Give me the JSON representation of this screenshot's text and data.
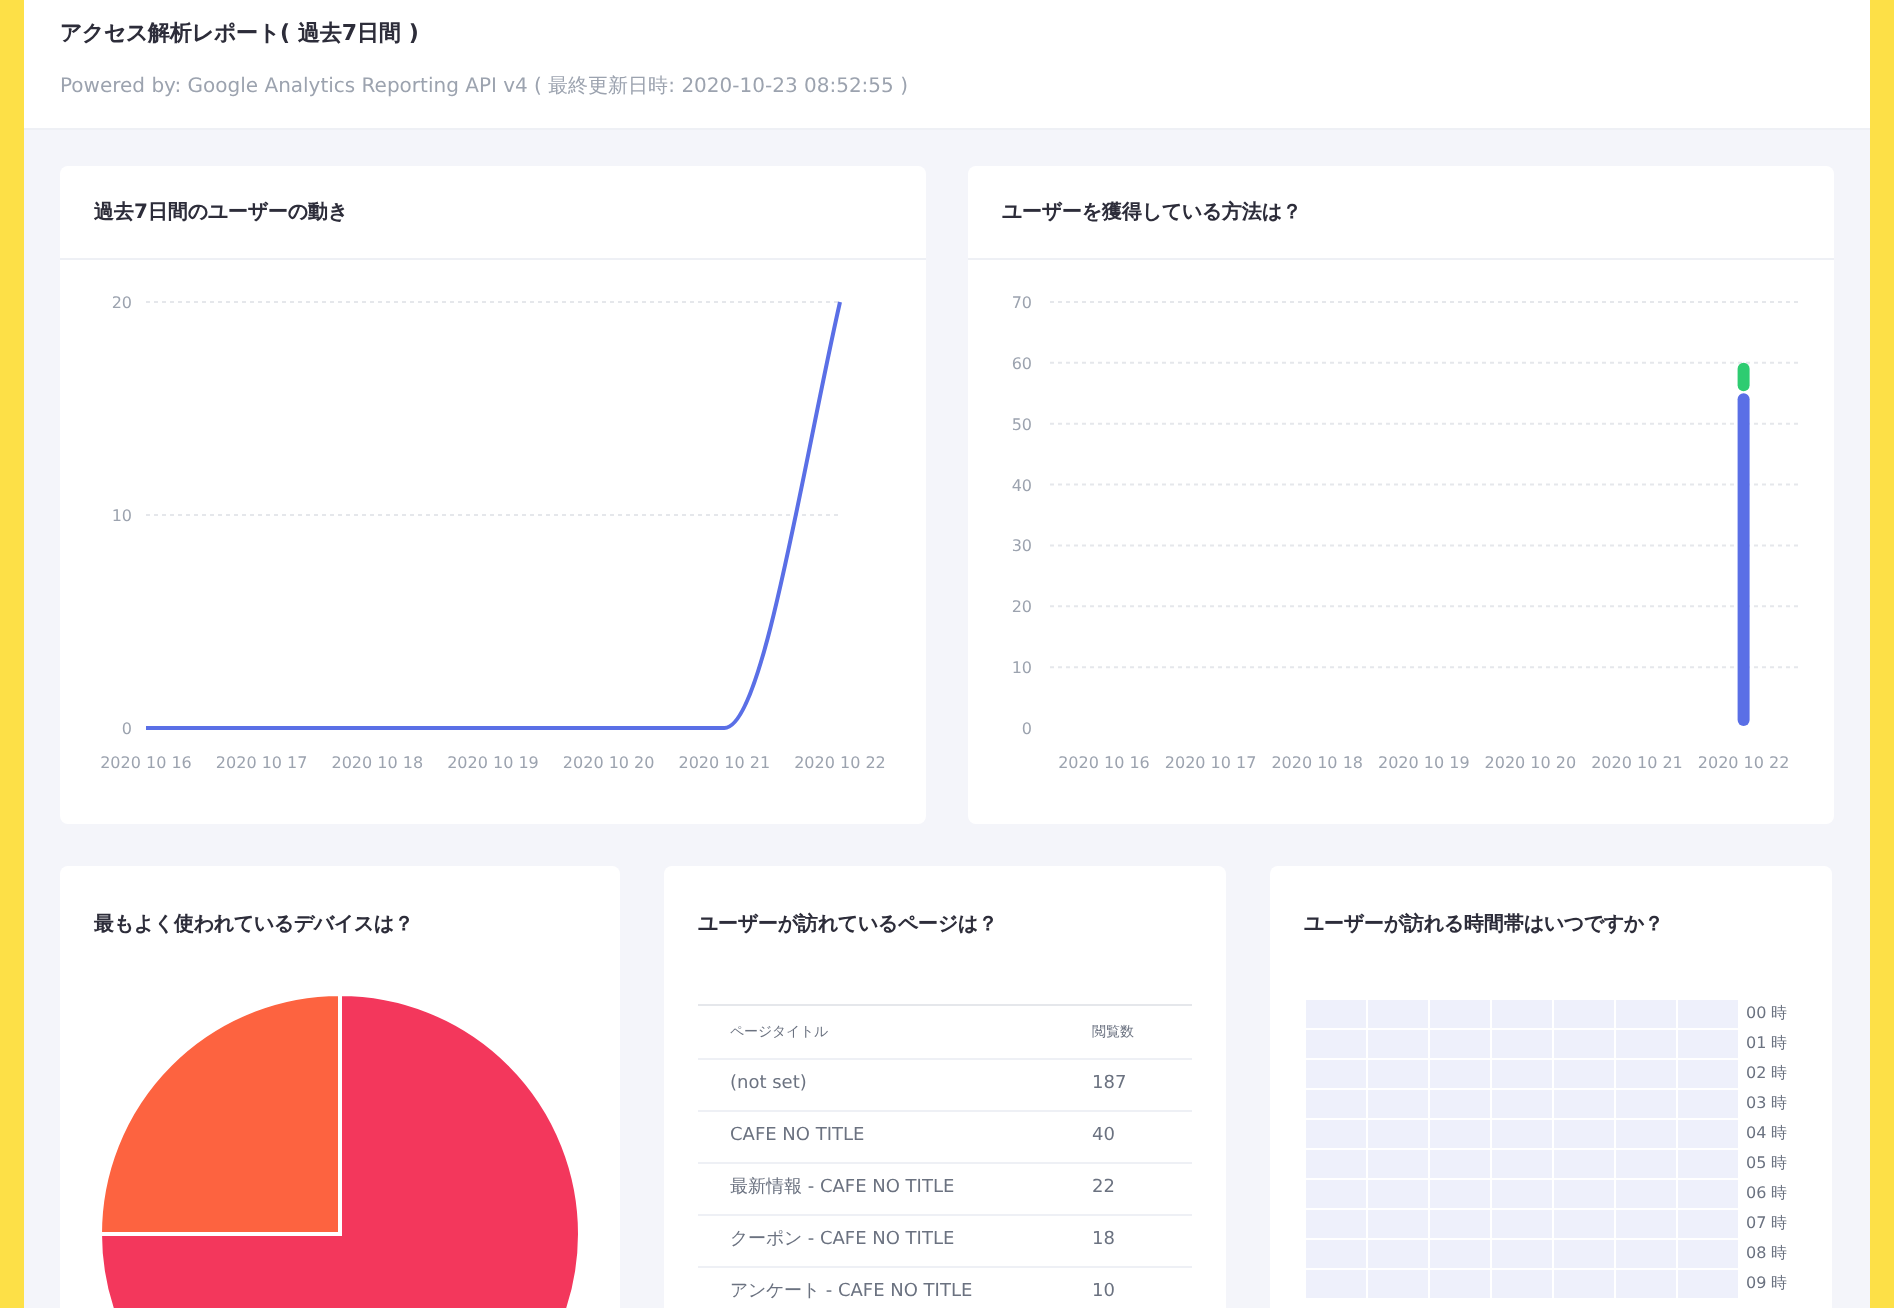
{
  "header": {
    "title": "アクセス解析レポート( 過去7日間 )",
    "subtitle": "Powered by: Google Analytics Reporting API v4 ( 最終更新日時: 2020-10-23 08:52:55 )"
  },
  "users_chart": {
    "title": "過去7日間のユーザーの動き",
    "chart_data": {
      "type": "line",
      "categories": [
        "2020 10 16",
        "2020 10 17",
        "2020 10 18",
        "2020 10 19",
        "2020 10 20",
        "2020 10 21",
        "2020 10 22"
      ],
      "series": [
        {
          "color": "#5a6fe6",
          "values": [
            0,
            0,
            0,
            0,
            0,
            0,
            20
          ]
        }
      ],
      "ylim": [
        0,
        20
      ],
      "yticks": [
        0,
        10,
        20
      ],
      "grid": true
    }
  },
  "acquisition_chart": {
    "title": "ユーザーを獲得している方法は？",
    "chart_data": {
      "type": "bar",
      "stacked": true,
      "categories": [
        "2020 10 16",
        "2020 10 17",
        "2020 10 18",
        "2020 10 19",
        "2020 10 20",
        "2020 10 21",
        "2020 10 22"
      ],
      "series": [
        {
          "color": "#5a6fe6",
          "values": [
            0,
            0,
            0,
            0,
            0,
            0,
            55
          ]
        },
        {
          "color": "#2ecc71",
          "values": [
            0,
            0,
            0,
            0,
            0,
            0,
            5
          ]
        }
      ],
      "ylim": [
        0,
        70
      ],
      "yticks": [
        0,
        10,
        20,
        30,
        40,
        50,
        60,
        70
      ],
      "grid": true
    }
  },
  "devices": {
    "title": "最もよく使われているデバイスは？"
  },
  "pages": {
    "title": "ユーザーが訪れているページは？",
    "columns": [
      "ページタイトル",
      "閲覧数"
    ],
    "rows": [
      [
        "(not set)",
        "187"
      ],
      [
        "CAFE NO TITLE",
        "40"
      ],
      [
        "最新情報 - CAFE NO TITLE",
        "22"
      ],
      [
        "クーポン - CAFE NO TITLE",
        "18"
      ],
      [
        "アンケート - CAFE NO TITLE",
        "10"
      ]
    ]
  },
  "hours": {
    "title": "ユーザーが訪れる時間帯はいつですか？",
    "labels": [
      "00 時",
      "01 時",
      "02 時",
      "03 時",
      "04 時",
      "05 時",
      "06 時",
      "07 時",
      "08 時",
      "09 時"
    ]
  }
}
